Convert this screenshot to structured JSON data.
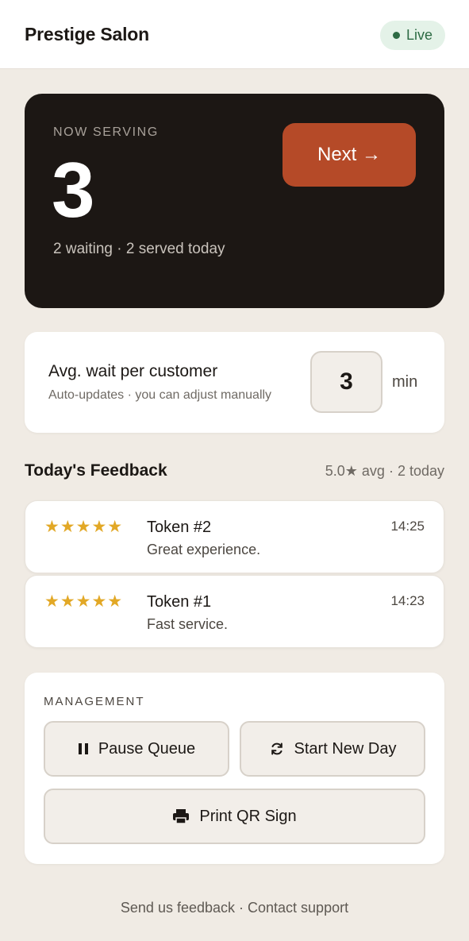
{
  "header": {
    "title": "Prestige Salon",
    "status": "Live"
  },
  "serving": {
    "label": "NOW SERVING",
    "number": "3",
    "summary": "2 waiting · 2 served today",
    "next_label": "Next →"
  },
  "wait": {
    "title": "Avg. wait per customer",
    "subtitle": "Auto-updates · you can adjust manually",
    "value": "3",
    "unit": "min"
  },
  "feedback": {
    "title": "Today's Feedback",
    "summary": "5.0★ avg · 2 today",
    "items": [
      {
        "stars": "★★★★★",
        "rating": 5,
        "token": "Token #2",
        "text": "Great experience.",
        "time": "14:25"
      },
      {
        "stars": "★★★★★",
        "rating": 5,
        "token": "Token #1",
        "text": "Fast service.",
        "time": "14:23"
      }
    ]
  },
  "management": {
    "label": "MANAGEMENT",
    "pause_label": "Pause Queue",
    "new_day_label": "Start New Day",
    "print_label": "Print QR Sign"
  },
  "footer": {
    "feedback_link": "Send us feedback",
    "separator": " · ",
    "support_link": "Contact support"
  },
  "colors": {
    "background": "#f0ebe4",
    "accent": "#b54a28",
    "serving_bg": "#1c1714",
    "live_green": "#2d6b44",
    "star": "#e2a826"
  },
  "icons": [
    "live-dot-icon",
    "pause-icon",
    "refresh-icon",
    "printer-icon"
  ]
}
